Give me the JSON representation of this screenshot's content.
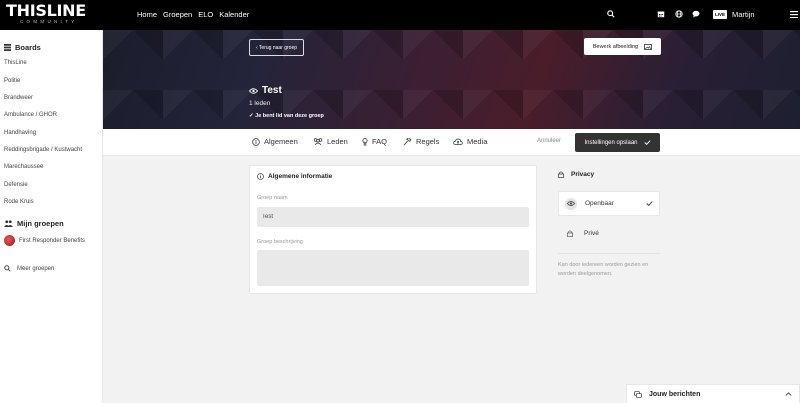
{
  "brand": {
    "name": "THISLINE",
    "sub": "COMMUNITY"
  },
  "nav": {
    "items": [
      "Home",
      "Groepen",
      "ELO",
      "Kalender"
    ]
  },
  "topbar": {
    "live_badge": "LIVE",
    "user_name": "Martijn"
  },
  "sidebar": {
    "boards_heading": "Boards",
    "boards": [
      "ThisLine",
      "Politie",
      "Brandweer",
      "Ambulance / GHOR",
      "Handhaving",
      "Reddingsbrigade / Kustwacht",
      "Marechaussee",
      "Defensie",
      "Rode Kruis"
    ],
    "groups_heading": "Mijn groepen",
    "groups": [
      "First Responder Benefits"
    ],
    "more_groups": "Meer groepen"
  },
  "banner": {
    "back_label": "‹ Terug naar groep",
    "edit_image_label": "Bewerk afbeelding",
    "group_name": "Test",
    "members": "1 leden",
    "member_status": "✓ Je bent lid van deze groep"
  },
  "tabs": [
    "Algemeen",
    "Leden",
    "FAQ",
    "Regels",
    "Media"
  ],
  "actions": {
    "cancel": "Annuleer",
    "save": "Instellingen opslaan"
  },
  "general": {
    "title": "Algemene informatie",
    "name_label": "Groep naam",
    "name_value": "Test",
    "description_label": "Groep beschrijving",
    "description_value": ""
  },
  "privacy": {
    "title": "Privacy",
    "options": [
      "Openbaar",
      "Privé"
    ],
    "selected": "Openbaar",
    "description": "Kan door iedereen worden gezien en worden deelgenomen."
  },
  "messages": {
    "label": "Jouw berichten"
  },
  "colors": {
    "topbar": "#000000",
    "save_button": "#333333",
    "input_bg": "#e9e9e9"
  }
}
